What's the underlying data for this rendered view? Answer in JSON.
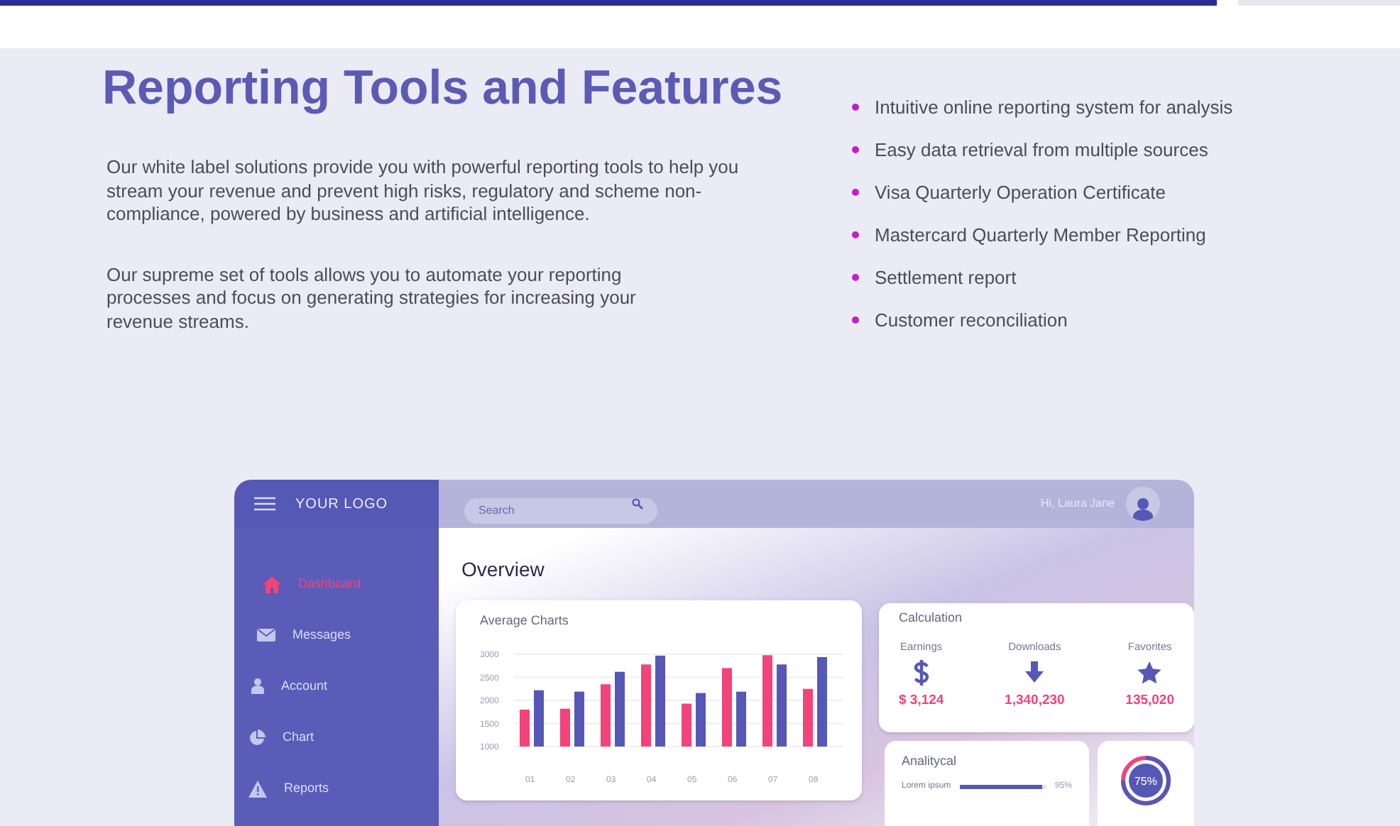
{
  "heading": "Reporting Tools and Features",
  "paragraphs": [
    "Our white label solutions provide you with powerful reporting tools to help you stream your revenue and prevent high risks, regulatory and scheme non-compliance, powered by business and artificial intelligence.",
    "Our supreme set of tools allows you to automate your reporting processes and focus on generating strategies for increasing your revenue streams."
  ],
  "features": [
    "Intuitive online reporting system for analysis",
    "Easy data retrieval from multiple sources",
    "Visa Quarterly Operation Certificate",
    "Mastercard Quarterly Member Reporting",
    "Settlement report",
    "Customer reconciliation"
  ],
  "dashboard": {
    "logo": "YOUR LOGO",
    "search": {
      "placeholder": "Search"
    },
    "greeting": "Hi, Laura Jane",
    "nav": [
      {
        "label": "Dashboard",
        "selected": true
      },
      {
        "label": "Messages",
        "selected": false
      },
      {
        "label": "Account",
        "selected": false
      },
      {
        "label": "Chart",
        "selected": false
      },
      {
        "label": "Reports",
        "selected": false
      }
    ],
    "title": "Overview",
    "chart_card": {
      "title": "Average Charts",
      "chart_data": {
        "type": "bar",
        "categories": [
          "01",
          "02",
          "03",
          "04",
          "05",
          "06",
          "07",
          "08"
        ],
        "grid": true,
        "series": [
          {
            "color": "#f2437a",
            "values": [
              1800,
              1820,
              2350,
              2780,
              1930,
              2700,
              2980,
              2250
            ]
          },
          {
            "color": "#5558b5",
            "values": [
              2220,
              2190,
              2620,
              2970,
              2160,
              2190,
              2780,
              2940
            ]
          }
        ],
        "ylim": [
          1000,
          3000
        ],
        "yticks": [
          1000,
          1500,
          2000,
          2500,
          3000
        ]
      }
    },
    "calculation": {
      "title": "Calculation",
      "stats": [
        {
          "label": "Earnings",
          "value": "$ 3,124"
        },
        {
          "label": "Downloads",
          "value": "1,340,230"
        },
        {
          "label": "Favorites",
          "value": "135,020"
        }
      ]
    },
    "analytical": {
      "title": "Analitycal",
      "rows": [
        {
          "label": "Lorem ipsum",
          "level": 0.95,
          "reading": "95%"
        }
      ]
    },
    "donut": {
      "level": 0.75,
      "reading": "75%"
    }
  }
}
